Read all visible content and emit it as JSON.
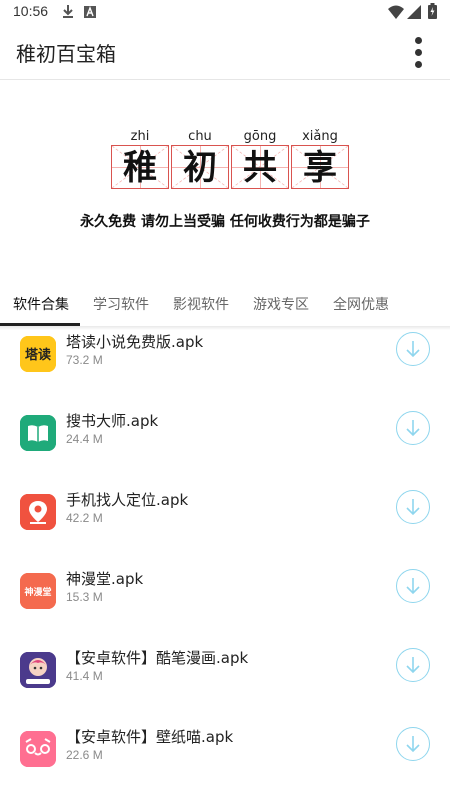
{
  "status_bar": {
    "time": "10:56",
    "icons": [
      "download-icon",
      "font-icon",
      "wifi-icon",
      "signal-icon",
      "battery-charging-icon"
    ]
  },
  "app_bar": {
    "title": "稚初百宝箱",
    "overflow_icon": "more-vert-icon"
  },
  "banner": {
    "pinyin": [
      "zhi",
      "chu",
      "gōng",
      "xiǎng"
    ],
    "characters": [
      "稚",
      "初",
      "共",
      "享"
    ],
    "notice": "永久免费 请勿上当受骗 任何收费行为都是骗子",
    "box_color": "#d9534f"
  },
  "tabs": [
    {
      "label": "软件合集",
      "active": true
    },
    {
      "label": "学习软件",
      "active": false
    },
    {
      "label": "影视软件",
      "active": false
    },
    {
      "label": "游戏专区",
      "active": false
    },
    {
      "label": "全网优惠",
      "active": false
    }
  ],
  "items": [
    {
      "name": "塔读小说免费版.apk",
      "size": "73.2 M",
      "icon": "tadu-icon"
    },
    {
      "name": "搜书大师.apk",
      "size": "24.4 M",
      "icon": "book-icon"
    },
    {
      "name": "手机找人定位.apk",
      "size": "42.2 M",
      "icon": "location-pin-icon"
    },
    {
      "name": "神漫堂.apk",
      "size": "15.3 M",
      "icon": "shenmantang-icon"
    },
    {
      "name": "【安卓软件】酷笔漫画.apk",
      "size": "41.4 M",
      "icon": "kubi-manhua-icon"
    },
    {
      "name": "【安卓软件】壁纸喵.apk",
      "size": "22.6 M",
      "icon": "bizhimiao-icon"
    }
  ],
  "colors": {
    "download_accent": "#8fd6ee",
    "tadu": "#ffc61a",
    "book": "#1faa7a",
    "location": "#f0523f",
    "shenmantang": "#f46a4e",
    "kubi": "#4b3a8c",
    "bizhimiao": "#ff6f91"
  },
  "icon_text": {
    "tadu": "塔读",
    "shenmantang": "神漫堂"
  }
}
